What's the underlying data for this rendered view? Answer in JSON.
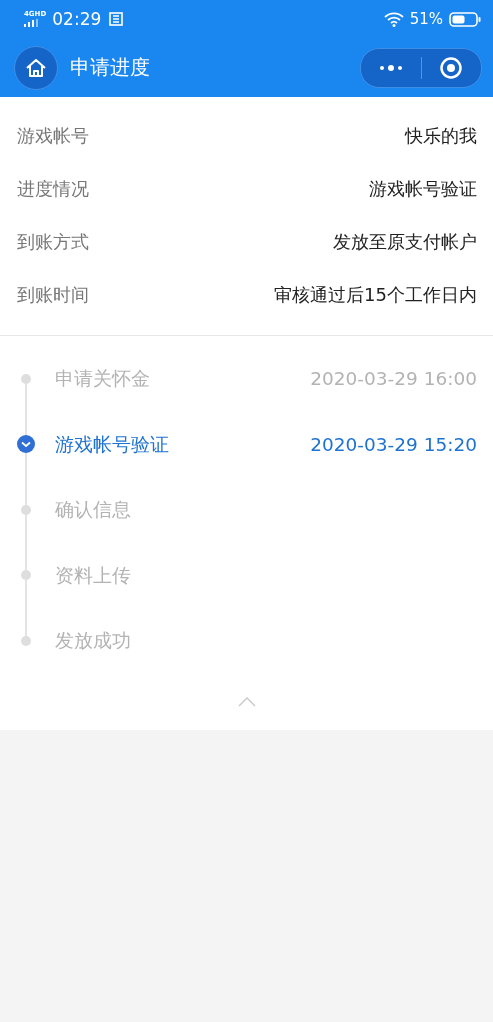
{
  "status_bar": {
    "network": "4GHD",
    "time": "02:29",
    "battery": "51%"
  },
  "nav": {
    "title": "申请进度"
  },
  "info": [
    {
      "label": "游戏帐号",
      "value": "快乐的我"
    },
    {
      "label": "进度情况",
      "value": "游戏帐号验证"
    },
    {
      "label": "到账方式",
      "value": "发放至原支付帐户"
    },
    {
      "label": "到账时间",
      "value": "审核通过后15个工作日内"
    }
  ],
  "steps": [
    {
      "name": "申请关怀金",
      "time": "2020-03-29 16:00",
      "selected": false
    },
    {
      "name": "游戏帐号验证",
      "time": "2020-03-29 15:20",
      "selected": true
    },
    {
      "name": "确认信息",
      "selected": false
    },
    {
      "name": "资料上传",
      "selected": false
    },
    {
      "name": "发放成功",
      "selected": false
    }
  ]
}
